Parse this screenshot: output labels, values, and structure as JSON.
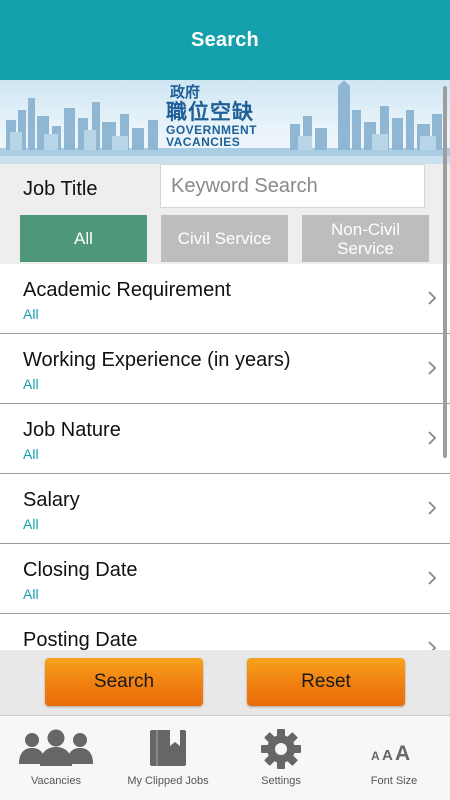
{
  "header": {
    "title": "Search"
  },
  "banner": {
    "logo_zh_small": "政府",
    "logo_zh_big": "職位空缺",
    "logo_en_line1": "GOVERNMENT",
    "logo_en_line2": "VACANCIES"
  },
  "filter": {
    "job_title_label": "Job Title",
    "keyword_placeholder": "Keyword Search",
    "keyword_value": "",
    "segments": [
      {
        "label": "All",
        "selected": true
      },
      {
        "label": "Civil Service",
        "selected": false
      },
      {
        "label": "Non-Civil Service",
        "selected": false
      }
    ]
  },
  "criteria": [
    {
      "label": "Academic Requirement",
      "value": "All"
    },
    {
      "label": "Working Experience (in years)",
      "value": "All"
    },
    {
      "label": "Job Nature",
      "value": "All"
    },
    {
      "label": "Salary",
      "value": "All"
    },
    {
      "label": "Closing Date",
      "value": "All"
    },
    {
      "label": "Posting Date",
      "value": ""
    }
  ],
  "actions": {
    "search_label": "Search",
    "reset_label": "Reset"
  },
  "bottom_nav": [
    {
      "label": "Vacancies",
      "icon": "people-icon"
    },
    {
      "label": "My Clipped Jobs",
      "icon": "bookmark-book-icon"
    },
    {
      "label": "Settings",
      "icon": "gear-icon"
    },
    {
      "label": "Font Size",
      "icon": "font-size-icon"
    }
  ],
  "colors": {
    "header": "#14a0ad",
    "segment_selected": "#4f977a",
    "segment_unselected": "#bdbdbd",
    "accent_value": "#14a0ad",
    "action_button": "#f07f10"
  }
}
